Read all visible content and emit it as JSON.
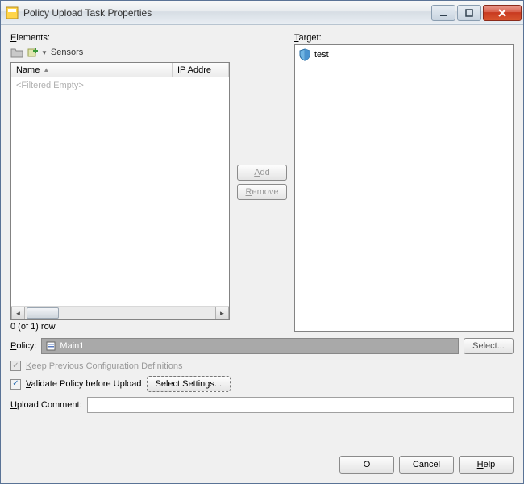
{
  "window": {
    "title": "Policy Upload Task Properties"
  },
  "elements": {
    "label": "Elements:",
    "toolbar_label": "Sensors",
    "columns": {
      "name": "Name",
      "ip": "IP Addre"
    },
    "placeholder": "<Filtered Empty>",
    "row_count": "0 (of 1) row"
  },
  "target": {
    "label": "Target:",
    "items": [
      "test"
    ]
  },
  "buttons": {
    "add": "Add",
    "remove": "Remove",
    "select": "Select...",
    "select_settings": "Select Settings...",
    "ok": "O",
    "cancel": "Cancel",
    "help": "Help"
  },
  "policy": {
    "label": "Policy:",
    "value": "Main1"
  },
  "checks": {
    "keep_prev": "Keep Previous Configuration Definitions",
    "validate": "Validate Policy before Upload"
  },
  "comment": {
    "label": "Upload Comment:",
    "value": ""
  }
}
